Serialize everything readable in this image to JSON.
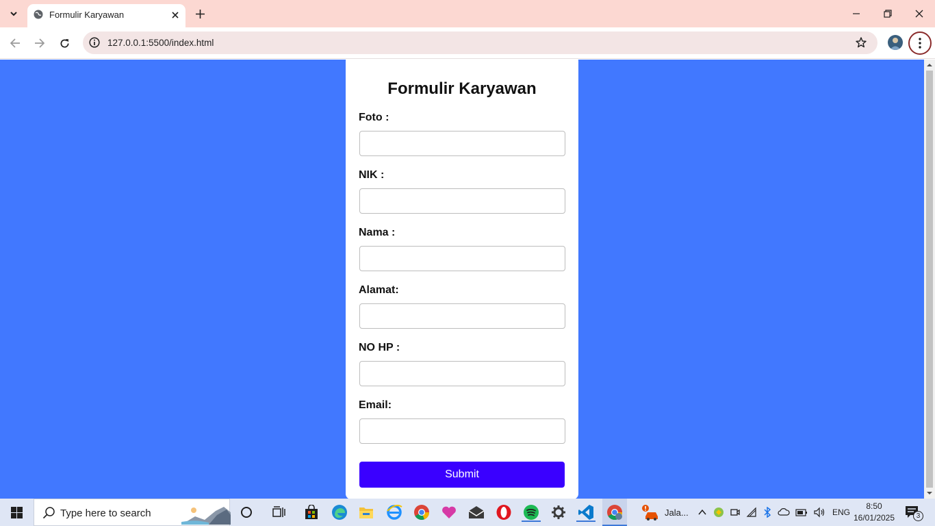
{
  "browser": {
    "tab_title": "Formulir Karyawan",
    "url": "127.0.0.1:5500/index.html"
  },
  "form": {
    "title": "Formulir Karyawan",
    "fields": [
      {
        "label": "Foto :",
        "value": ""
      },
      {
        "label": "NIK :",
        "value": ""
      },
      {
        "label": "Nama :",
        "value": ""
      },
      {
        "label": "Alamat:",
        "value": ""
      },
      {
        "label": "NO HP :",
        "value": ""
      },
      {
        "label": "Email:",
        "value": ""
      }
    ],
    "submit_label": "Submit"
  },
  "taskbar": {
    "search_placeholder": "Type here to search",
    "notification_app_label": "Jala...",
    "language": "ENG",
    "time": "8:50",
    "date": "16/01/2025",
    "notification_count": "3"
  },
  "colors": {
    "page_background": "#4178ff",
    "submit_button": "#3a00ff",
    "titlebar": "#fcd8d2"
  }
}
